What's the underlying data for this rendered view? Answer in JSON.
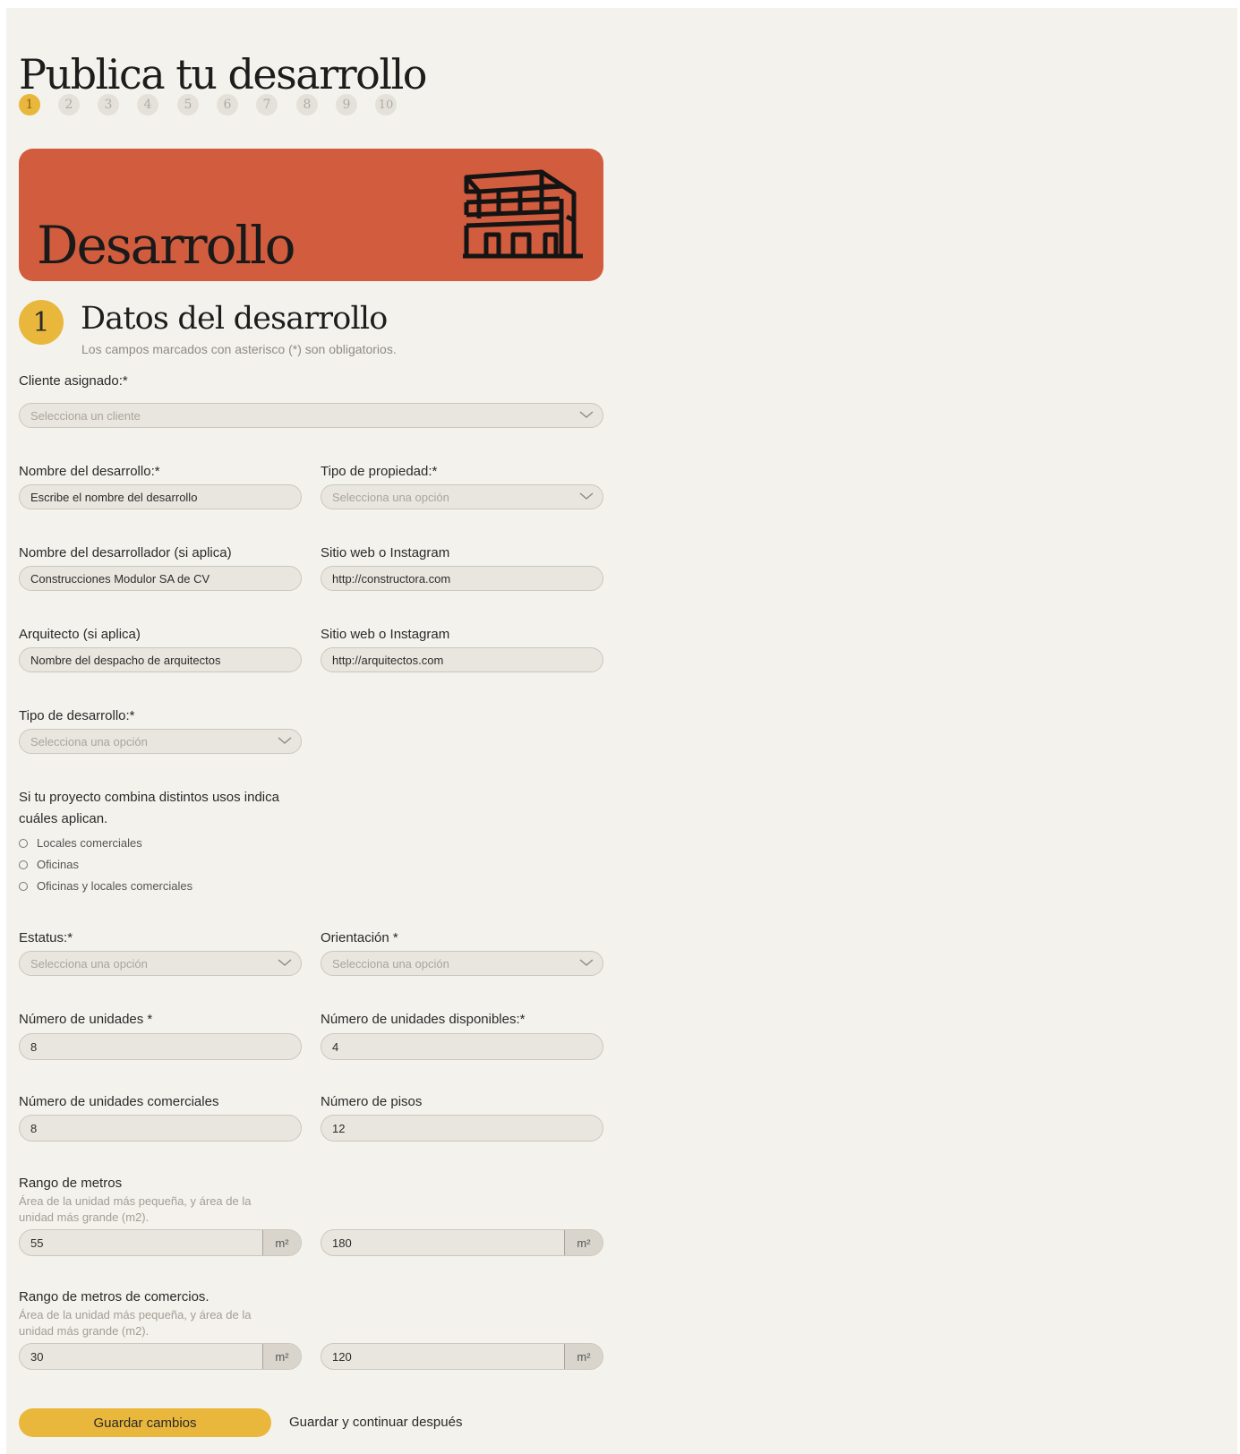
{
  "page": {
    "title": "Publica tu desarrollo"
  },
  "steps": [
    "1",
    "2",
    "3",
    "4",
    "5",
    "6",
    "7",
    "8",
    "9",
    "10"
  ],
  "hero": {
    "title": "Desarrollo",
    "icon": "building-icon"
  },
  "section": {
    "number": "1",
    "title": "Datos del desarrollo",
    "note": "Los campos marcados con asterisco (*) son obligatorios."
  },
  "form": {
    "cliente": {
      "label": "Cliente asignado:*",
      "placeholder": "Selecciona un cliente"
    },
    "nombre_desarrollo": {
      "label": "Nombre del desarrollo:*",
      "placeholder": "Escribe el nombre del desarrollo"
    },
    "tipo_propiedad": {
      "label": "Tipo de propiedad:*",
      "placeholder": "Selecciona una opción"
    },
    "desarrollador": {
      "label": "Nombre del desarrollador (si aplica)",
      "value": "Construcciones Modulor SA de CV"
    },
    "sitio_desarrollador": {
      "label": "Sitio web o Instagram",
      "value": "http://constructora.com"
    },
    "arquitecto": {
      "label": "Arquitecto (si aplica)",
      "placeholder": "Nombre del despacho de arquitectos"
    },
    "sitio_arquitecto": {
      "label": "Sitio web o Instagram",
      "value": "http://arquitectos.com"
    },
    "tipo_desarrollo": {
      "label": "Tipo de desarrollo:*",
      "placeholder": "Selecciona una opción"
    },
    "usos": {
      "label_line1": "Si tu proyecto combina distintos usos indica",
      "label_line2": "cuáles aplican.",
      "options": [
        "Locales comerciales",
        "Oficinas",
        "Oficinas y locales comerciales"
      ]
    },
    "estatus": {
      "label": "Estatus:*",
      "placeholder": "Selecciona una opción"
    },
    "orientacion": {
      "label": "Orientación *",
      "placeholder": "Selecciona una opción"
    },
    "num_unidades": {
      "label": "Número de unidades *",
      "value": "8"
    },
    "num_disponibles": {
      "label": "Número de unidades disponibles:*",
      "value": "4"
    },
    "num_comerciales": {
      "label": "Número de unidades comerciales",
      "value": "8"
    },
    "num_pisos": {
      "label": "Número de pisos",
      "value": "12"
    },
    "rango_metros": {
      "label": "Rango de metros",
      "hint_line1": "Área de la unidad más pequeña, y área de la",
      "hint_line2": "unidad más grande (m2).",
      "min": "55",
      "max": "180",
      "unit": "m²"
    },
    "rango_comercios": {
      "label": "Rango de metros de comercios.",
      "hint_line1": "Área de la unidad más pequeña, y área de la",
      "hint_line2": "unidad más grande (m2).",
      "min": "30",
      "max": "120",
      "unit": "m²"
    }
  },
  "actions": {
    "save": "Guardar cambios",
    "later": "Guardar y continuar después"
  },
  "colors": {
    "accent": "#e8b73c",
    "hero": "#d15c3e",
    "background": "#f4f2ec"
  }
}
